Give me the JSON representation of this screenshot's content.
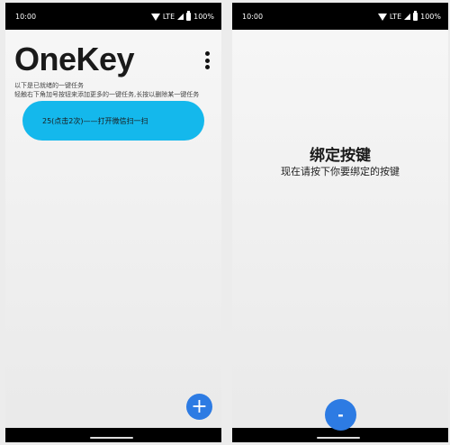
{
  "screens": [
    {
      "status": {
        "time": "10:00",
        "network": "LTE",
        "battery": "100%"
      },
      "app_title": "OneKey",
      "hints": [
        "以下是已就绪的一键任务",
        "轻触右下角加号按钮来添加更多的一键任务,长按以删除某一键任务"
      ],
      "tasks": [
        {
          "label": "25(点击2次)——打开微信扫一扫"
        }
      ],
      "fab_label": "+"
    },
    {
      "status": {
        "time": "10:00",
        "network": "LTE",
        "battery": "100%"
      },
      "bind_title": "绑定按键",
      "bind_subtitle": "现在请按下你要绑定的按键",
      "fab_label": "-"
    }
  ],
  "colors": {
    "accent_pill": "#14b8ec",
    "fab": "#2d7be3"
  }
}
